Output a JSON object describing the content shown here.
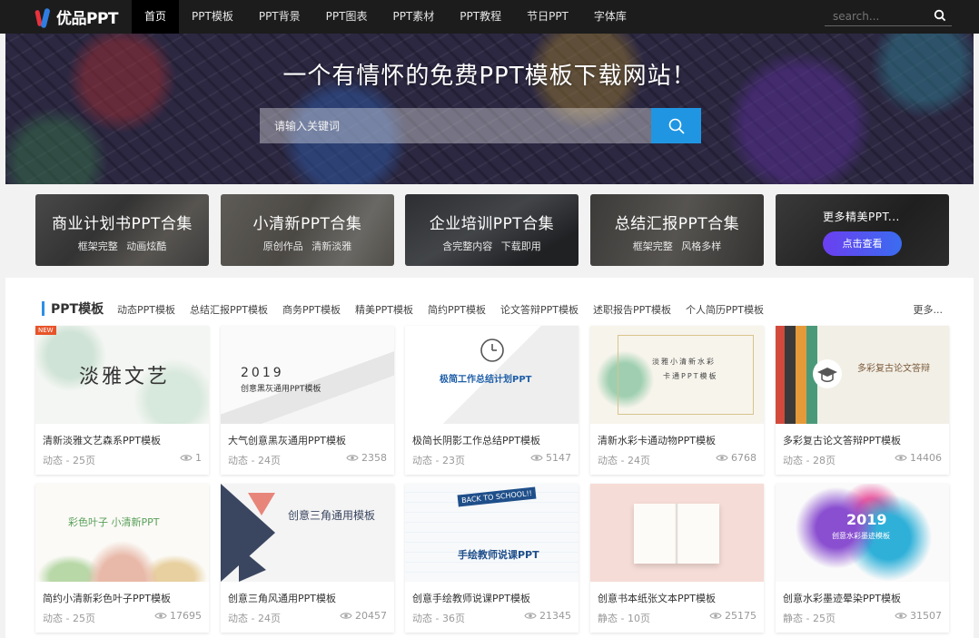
{
  "logo": {
    "text": "优品PPT"
  },
  "nav": {
    "items": [
      "首页",
      "PPT模板",
      "PPT背景",
      "PPT图表",
      "PPT素材",
      "PPT教程",
      "节日PPT",
      "字体库"
    ],
    "search_placeholder": "search..."
  },
  "banner": {
    "title": "一个有情怀的免费PPT模板下载网站！",
    "search_placeholder": "请输入关键词"
  },
  "collections": [
    {
      "title": "商业计划书PPT合集",
      "subtitle": "框架完整 动画炫酷"
    },
    {
      "title": "小清新PPT合集",
      "subtitle": "原创作品 清新淡雅"
    },
    {
      "title": "企业培训PPT合集",
      "subtitle": "含完整内容 下载即用"
    },
    {
      "title": "总结汇报PPT合集",
      "subtitle": "框架完整 风格多样"
    }
  ],
  "more_collection": {
    "title": "更多精美PPT...",
    "button": "点击查看"
  },
  "section": {
    "title": "PPT模板",
    "tabs": [
      "动态PPT模板",
      "总结汇报PPT模板",
      "商务PPT模板",
      "精美PPT模板",
      "简约PPT模板",
      "论文答辩PPT模板",
      "述职报告PPT模板",
      "个人简历PPT模板"
    ],
    "more": "更多..."
  },
  "cards": [
    {
      "name": "清新淡雅文艺森系PPT模板",
      "meta": "动态 - 25页",
      "views": "1",
      "badge": "NEW",
      "thumb_text": "淡雅文艺"
    },
    {
      "name": "大气创意黑灰通用PPT模板",
      "meta": "动态 - 24页",
      "views": "2358",
      "thumb_text": "2019",
      "thumb_text2": "创意黑灰通用PPT模板"
    },
    {
      "name": "极简长阴影工作总结PPT模板",
      "meta": "动态 - 23页",
      "views": "5147",
      "thumb_text": "极简工作总结计划PPT"
    },
    {
      "name": "清新水彩卡通动物PPT模板",
      "meta": "动态 - 24页",
      "views": "6768",
      "thumb_text": "淡雅小清新水彩",
      "thumb_text2": "卡通PPT模板"
    },
    {
      "name": "多彩复古论文答辩PPT模板",
      "meta": "动态 - 28页",
      "views": "14406",
      "thumb_text": "多彩复古论文答辩"
    },
    {
      "name": "简约小清新彩色叶子PPT模板",
      "meta": "动态 - 25页",
      "views": "17695",
      "thumb_text": "彩色叶子 小清新PPT"
    },
    {
      "name": "创意三角风通用PPT模板",
      "meta": "动态 - 24页",
      "views": "20457",
      "thumb_text": "创意三角通用模板"
    },
    {
      "name": "创意手绘教师说课PPT模板",
      "meta": "动态 - 36页",
      "views": "21345",
      "thumb_text": "手绘教师说课PPT",
      "thumb_text2": "BACK TO SCHOOL!!"
    },
    {
      "name": "创意书本纸张文本PPT模板",
      "meta": "静态 - 10页",
      "views": "25175"
    },
    {
      "name": "创意水彩墨迹晕染PPT模板",
      "meta": "静态 - 25页",
      "views": "31507",
      "thumb_text": "2019",
      "thumb_text2": "创意水彩墨迹模板"
    }
  ],
  "colors": {
    "accent": "#2096e3",
    "nav_bg": "#1c1c1c",
    "button_gradient_start": "#6b3ff0",
    "button_gradient_end": "#3a6cf0"
  }
}
